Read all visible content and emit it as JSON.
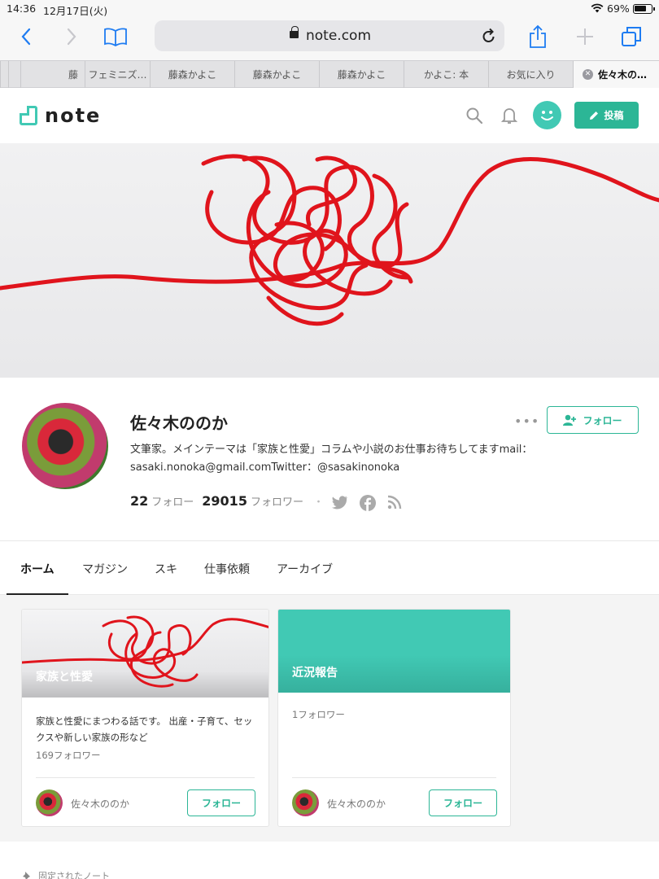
{
  "status_bar": {
    "time": "14:36",
    "date": "12月17日(火)",
    "battery": "69%"
  },
  "browser": {
    "url": "note.com",
    "tabs": [
      {
        "label": "藤"
      },
      {
        "label": "フェミニズ…"
      },
      {
        "label": "藤森かよこ"
      },
      {
        "label": "藤森かよこ"
      },
      {
        "label": "藤森かよこ"
      },
      {
        "label": "かよこ: 本"
      },
      {
        "label": "お気に入り"
      },
      {
        "label": "佐々木の…",
        "active": true
      }
    ]
  },
  "header": {
    "logo": "note",
    "post_label": "投稿"
  },
  "profile": {
    "name": "佐々木ののか",
    "follow_label": "フォロー",
    "bio_line1": "文筆家。メインテーマは「家族と性愛」コラムや小説のお仕事お待ちしてますmail：",
    "bio_line2": "sasaki.nonoka@gmail.comTwitter：@sasakinonoka",
    "following_count": "22",
    "following_label": "フォロー",
    "followers_count": "29015",
    "followers_label": "フォロワー",
    "separator": "・"
  },
  "nav_tabs": [
    {
      "label": "ホーム",
      "active": true
    },
    {
      "label": "マガジン"
    },
    {
      "label": "スキ"
    },
    {
      "label": "仕事依頼"
    },
    {
      "label": "アーカイブ"
    }
  ],
  "magazines": [
    {
      "title": "家族と性愛",
      "description": "家族と性愛にまつわる話です。 出産・子育て、セックスや新しい家族の形など",
      "followers": "169フォロワー",
      "author": "佐々木ののか",
      "follow_label": "フォロー"
    },
    {
      "title": "近況報告",
      "description": "",
      "followers": "1フォロワー",
      "author": "佐々木ののか",
      "follow_label": "フォロー"
    }
  ],
  "pinned_label": "固定されたノート",
  "colors": {
    "brand": "#2cb696",
    "accent": "#41c9b4",
    "yarn": "#e0141c"
  },
  "icons": [
    "back-icon",
    "forward-icon",
    "bookmarks-icon",
    "lock-icon",
    "reload-icon",
    "share-icon",
    "new-tab-icon",
    "tabs-icon",
    "search-icon",
    "bell-icon",
    "pencil-icon",
    "more-icon",
    "add-user-icon",
    "twitter-icon",
    "facebook-icon",
    "rss-icon",
    "pin-icon"
  ]
}
